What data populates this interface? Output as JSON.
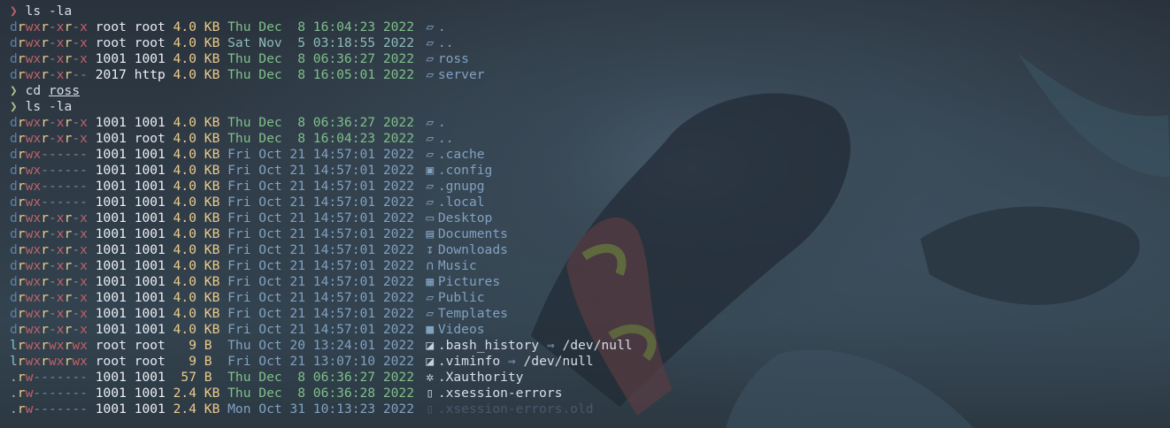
{
  "terminal": {
    "prompt_char": "❯",
    "blocks": [
      {
        "prompt_color": "red",
        "command": "ls",
        "args": "-la",
        "entries": [
          {
            "perm": "drwxr-xr-x",
            "user": "root",
            "group": "root",
            "size": "4.0",
            "unit": "KB",
            "date": "Thu Dec  8 16:04:23 2022",
            "date_style": "b",
            "icon": "folder-open-icon",
            "name": ".",
            "kind": "dir"
          },
          {
            "perm": "drwxr-xr-x",
            "user": "root",
            "group": "root",
            "size": "4.0",
            "unit": "KB",
            "date": "Sat Nov  5 03:18:55 2022",
            "date_style": "c",
            "icon": "folder-open-icon",
            "name": "..",
            "kind": "dir"
          },
          {
            "perm": "drwxr-xr-x",
            "user": "1001",
            "group": "1001",
            "size": "4.0",
            "unit": "KB",
            "date": "Thu Dec  8 06:36:27 2022",
            "date_style": "b",
            "icon": "folder-open-icon",
            "name": "ross",
            "kind": "dir"
          },
          {
            "perm": "drwxr-xr--",
            "user": "2017",
            "group": "http",
            "size": "4.0",
            "unit": "KB",
            "date": "Thu Dec  8 16:05:01 2022",
            "date_style": "b",
            "icon": "folder-open-icon",
            "name": "server",
            "kind": "dir"
          }
        ]
      },
      {
        "prompt_color": "green",
        "command": "cd",
        "args": "ross",
        "args_underlined": true,
        "entries": []
      },
      {
        "prompt_color": "green",
        "command": "ls",
        "args": "-la",
        "entries": [
          {
            "perm": "drwxr-xr-x",
            "user": "1001",
            "group": "1001",
            "size": "4.0",
            "unit": "KB",
            "date": "Thu Dec  8 06:36:27 2022",
            "date_style": "b",
            "icon": "folder-open-icon",
            "name": ".",
            "kind": "dir"
          },
          {
            "perm": "drwxr-xr-x",
            "user": "1001",
            "group": "root",
            "size": "4.0",
            "unit": "KB",
            "date": "Thu Dec  8 16:04:23 2022",
            "date_style": "b",
            "icon": "folder-open-icon",
            "name": "..",
            "kind": "dir"
          },
          {
            "perm": "drwx------",
            "user": "1001",
            "group": "1001",
            "size": "4.0",
            "unit": "KB",
            "date": "Fri Oct 21 14:57:01 2022",
            "date_style": "e",
            "icon": "folder-open-icon",
            "name": ".cache",
            "kind": "dir"
          },
          {
            "perm": "drwx------",
            "user": "1001",
            "group": "1001",
            "size": "4.0",
            "unit": "KB",
            "date": "Fri Oct 21 14:57:01 2022",
            "date_style": "e",
            "icon": "gear-folder-icon",
            "name": ".config",
            "kind": "dir"
          },
          {
            "perm": "drwx------",
            "user": "1001",
            "group": "1001",
            "size": "4.0",
            "unit": "KB",
            "date": "Fri Oct 21 14:57:01 2022",
            "date_style": "e",
            "icon": "folder-open-icon",
            "name": ".gnupg",
            "kind": "dir"
          },
          {
            "perm": "drwx------",
            "user": "1001",
            "group": "1001",
            "size": "4.0",
            "unit": "KB",
            "date": "Fri Oct 21 14:57:01 2022",
            "date_style": "e",
            "icon": "folder-open-icon",
            "name": ".local",
            "kind": "dir"
          },
          {
            "perm": "drwxr-xr-x",
            "user": "1001",
            "group": "1001",
            "size": "4.0",
            "unit": "KB",
            "date": "Fri Oct 21 14:57:01 2022",
            "date_style": "e",
            "icon": "desktop-icon",
            "name": "Desktop",
            "kind": "dir"
          },
          {
            "perm": "drwxr-xr-x",
            "user": "1001",
            "group": "1001",
            "size": "4.0",
            "unit": "KB",
            "date": "Fri Oct 21 14:57:01 2022",
            "date_style": "e",
            "icon": "book-icon",
            "name": "Documents",
            "kind": "dir"
          },
          {
            "perm": "drwxr-xr-x",
            "user": "1001",
            "group": "1001",
            "size": "4.0",
            "unit": "KB",
            "date": "Fri Oct 21 14:57:01 2022",
            "date_style": "e",
            "icon": "download-icon",
            "name": "Downloads",
            "kind": "dir"
          },
          {
            "perm": "drwxr-xr-x",
            "user": "1001",
            "group": "1001",
            "size": "4.0",
            "unit": "KB",
            "date": "Fri Oct 21 14:57:01 2022",
            "date_style": "e",
            "icon": "headphones-icon",
            "name": "Music",
            "kind": "dir"
          },
          {
            "perm": "drwxr-xr-x",
            "user": "1001",
            "group": "1001",
            "size": "4.0",
            "unit": "KB",
            "date": "Fri Oct 21 14:57:01 2022",
            "date_style": "e",
            "icon": "image-icon",
            "name": "Pictures",
            "kind": "dir"
          },
          {
            "perm": "drwxr-xr-x",
            "user": "1001",
            "group": "1001",
            "size": "4.0",
            "unit": "KB",
            "date": "Fri Oct 21 14:57:01 2022",
            "date_style": "e",
            "icon": "folder-open-icon",
            "name": "Public",
            "kind": "dir"
          },
          {
            "perm": "drwxr-xr-x",
            "user": "1001",
            "group": "1001",
            "size": "4.0",
            "unit": "KB",
            "date": "Fri Oct 21 14:57:01 2022",
            "date_style": "e",
            "icon": "folder-open-icon",
            "name": "Templates",
            "kind": "dir"
          },
          {
            "perm": "drwxr-xr-x",
            "user": "1001",
            "group": "1001",
            "size": "4.0",
            "unit": "KB",
            "date": "Fri Oct 21 14:57:01 2022",
            "date_style": "e",
            "icon": "video-icon",
            "name": "Videos",
            "kind": "dir"
          },
          {
            "perm": "lrwxrwxrwx",
            "user": "root",
            "group": "root",
            "size": "9",
            "unit": "B",
            "date": "Thu Oct 20 13:24:01 2022",
            "date_style": "e",
            "icon": "link-file-icon",
            "name": ".bash_history",
            "link_target": "/dev/null",
            "kind": "link"
          },
          {
            "perm": "lrwxrwxrwx",
            "user": "root",
            "group": "root",
            "size": "9",
            "unit": "B",
            "date": "Fri Oct 21 13:07:10 2022",
            "date_style": "e",
            "icon": "link-file-icon",
            "name": ".viminfo",
            "link_target": "/dev/null",
            "kind": "link"
          },
          {
            "perm": ".rw-------",
            "user": "1001",
            "group": "1001",
            "size": "57",
            "unit": "B",
            "date": "Thu Dec  8 06:36:27 2022",
            "date_style": "b",
            "icon": "gear-icon",
            "name": ".Xauthority",
            "kind": "file"
          },
          {
            "perm": ".rw-------",
            "user": "1001",
            "group": "1001",
            "size": "2.4",
            "unit": "KB",
            "date": "Thu Dec  8 06:36:28 2022",
            "date_style": "b",
            "icon": "file-icon",
            "name": ".xsession-errors",
            "kind": "file"
          },
          {
            "perm": ".rw-------",
            "user": "1001",
            "group": "1001",
            "size": "2.4",
            "unit": "KB",
            "date": "Mon Oct 31 10:13:23 2022",
            "date_style": "e",
            "icon": "file-icon",
            "name": ".xsession-errors.old",
            "kind": "dimfile"
          }
        ]
      }
    ],
    "link_arrow": "⇒"
  }
}
